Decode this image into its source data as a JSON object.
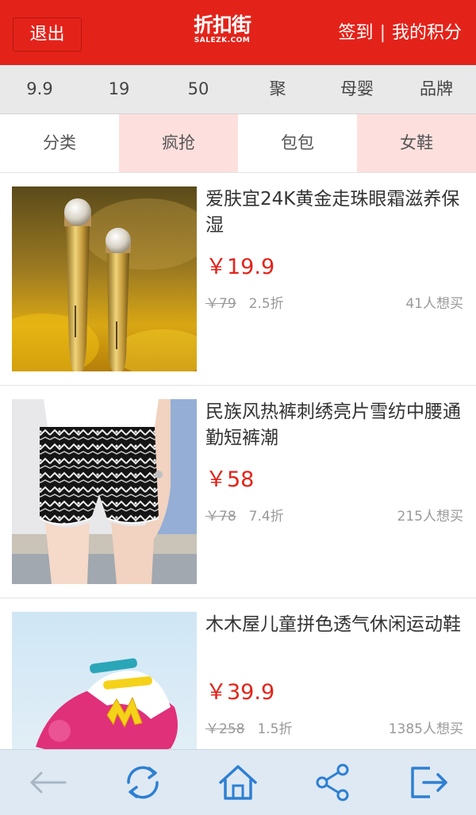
{
  "header": {
    "logout": "退出",
    "logo_cn": "折扣街",
    "logo_en": "SALEZK.COM",
    "checkin": "签到",
    "separator": "|",
    "points": "我的积分"
  },
  "price_filters": [
    "9.9",
    "19",
    "50",
    "聚",
    "母婴",
    "品牌"
  ],
  "categories": [
    "分类",
    "疯抢",
    "包包",
    "女鞋"
  ],
  "products": [
    {
      "name": "爱肤宜24K黄金走珠眼霜滋养保湿",
      "price": "￥19.9",
      "original": "￥79",
      "discount": "2.5折",
      "wants": "41人想买",
      "image_icon": "eye-cream-image"
    },
    {
      "name": "民族风热裤刺绣亮片雪纺中腰通勤短裤潮",
      "price": "￥58",
      "original": "￥78",
      "discount": "7.4折",
      "wants": "215人想买",
      "image_icon": "shorts-image"
    },
    {
      "name": "木木屋儿童拼色透气休闲运动鞋",
      "price": "￥39.9",
      "original": "￥258",
      "discount": "1.5折",
      "wants": "1385人想买",
      "image_icon": "kids-shoe-image"
    }
  ],
  "bottom_nav": [
    "back-icon",
    "refresh-icon",
    "home-icon",
    "share-icon",
    "exit-icon"
  ],
  "colors": {
    "brand_red": "#e3231a",
    "tab_pink": "#fde0de",
    "nav_bg": "#dfe9f3",
    "icon_blue": "#2d7fd3"
  }
}
